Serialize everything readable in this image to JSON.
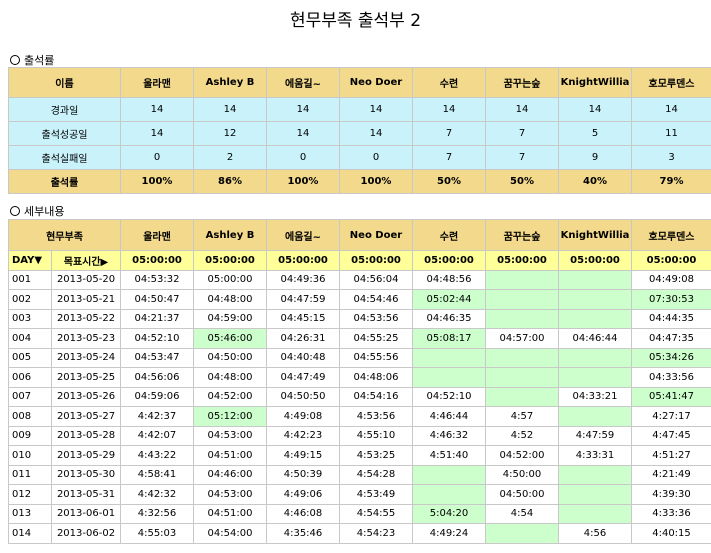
{
  "title": "현무부족 출석부 2",
  "sections": {
    "summary": "출석률",
    "detail": "세부내용"
  },
  "summary": {
    "corner": "이름",
    "members": [
      "울라맨",
      "Ashley B",
      "에움길~",
      "Neo Doer",
      "수련",
      "꿈꾸는숲",
      "KnightWillia",
      "호모루덴스"
    ],
    "rows": [
      {
        "label": "경과일",
        "values": [
          "14",
          "14",
          "14",
          "14",
          "14",
          "14",
          "14",
          "14"
        ]
      },
      {
        "label": "출석성공일",
        "values": [
          "14",
          "12",
          "14",
          "14",
          "7",
          "7",
          "5",
          "11"
        ]
      },
      {
        "label": "출석실패일",
        "values": [
          "0",
          "2",
          "0",
          "0",
          "7",
          "7",
          "9",
          "3"
        ]
      }
    ],
    "ratio": {
      "label": "출석률",
      "values": [
        "100%",
        "86%",
        "100%",
        "100%",
        "50%",
        "50%",
        "40%",
        "79%"
      ]
    }
  },
  "detail": {
    "corner": "현무부족",
    "members": [
      "울라맨",
      "Ashley B",
      "에움길~",
      "Neo Doer",
      "수련",
      "꿈꾸는숲",
      "KnightWillia",
      "호모루덴스"
    ],
    "target": {
      "day_label": "DAY▼",
      "target_label": "목표시간▶",
      "values": [
        "05:00:00",
        "05:00:00",
        "05:00:00",
        "05:00:00",
        "05:00:00",
        "05:00:00",
        "05:00:00",
        "05:00:00"
      ]
    },
    "rows": [
      {
        "day": "001",
        "date": "2013-05-20",
        "values": [
          "04:53:32",
          "05:00:00",
          "04:49:36",
          "04:56:04",
          "04:48:56",
          "",
          "",
          "04:49:08"
        ],
        "green": [
          false,
          false,
          false,
          false,
          false,
          true,
          true,
          false
        ]
      },
      {
        "day": "002",
        "date": "2013-05-21",
        "values": [
          "04:50:47",
          "04:48:00",
          "04:47:59",
          "04:54:46",
          "05:02:44",
          "",
          "",
          "07:30:53"
        ],
        "green": [
          false,
          false,
          false,
          false,
          true,
          true,
          true,
          true
        ]
      },
      {
        "day": "003",
        "date": "2013-05-22",
        "values": [
          "04:21:37",
          "04:59:00",
          "04:45:15",
          "04:53:56",
          "04:46:35",
          "",
          "",
          "04:44:35"
        ],
        "green": [
          false,
          false,
          false,
          false,
          false,
          true,
          true,
          false
        ]
      },
      {
        "day": "004",
        "date": "2013-05-23",
        "values": [
          "04:52:10",
          "05:46:00",
          "04:26:31",
          "04:55:25",
          "05:08:17",
          "04:57:00",
          "04:46:44",
          "04:47:35"
        ],
        "green": [
          false,
          true,
          false,
          false,
          true,
          false,
          false,
          false
        ]
      },
      {
        "day": "005",
        "date": "2013-05-24",
        "values": [
          "04:53:47",
          "04:50:00",
          "04:40:48",
          "04:55:56",
          "",
          "",
          "",
          "05:34:26"
        ],
        "green": [
          false,
          false,
          false,
          false,
          true,
          true,
          true,
          true
        ]
      },
      {
        "day": "006",
        "date": "2013-05-25",
        "values": [
          "04:56:06",
          "04:48:00",
          "04:47:49",
          "04:48:06",
          "",
          "",
          "",
          "04:33:56"
        ],
        "green": [
          false,
          false,
          false,
          false,
          true,
          true,
          true,
          false
        ]
      },
      {
        "day": "007",
        "date": "2013-05-26",
        "values": [
          "04:59:06",
          "04:52:00",
          "04:50:50",
          "04:54:16",
          "04:52:10",
          "",
          "04:33:21",
          "05:41:47"
        ],
        "green": [
          false,
          false,
          false,
          false,
          false,
          true,
          false,
          true
        ]
      },
      {
        "day": "008",
        "date": "2013-05-27",
        "values": [
          "4:42:37",
          "05:12:00",
          "4:49:08",
          "4:53:56",
          "4:46:44",
          "4:57",
          "",
          "4:27:17"
        ],
        "green": [
          false,
          true,
          false,
          false,
          false,
          false,
          true,
          false
        ]
      },
      {
        "day": "009",
        "date": "2013-05-28",
        "values": [
          "4:42:07",
          "04:53:00",
          "4:42:23",
          "4:55:10",
          "4:46:32",
          "4:52",
          "4:47:59",
          "4:47:45"
        ],
        "green": [
          false,
          false,
          false,
          false,
          false,
          false,
          false,
          false
        ]
      },
      {
        "day": "010",
        "date": "2013-05-29",
        "values": [
          "4:43:22",
          "04:51:00",
          "4:49:15",
          "4:53:25",
          "4:51:40",
          "04:52:00",
          "4:33:31",
          "4:51:27"
        ],
        "green": [
          false,
          false,
          false,
          false,
          false,
          false,
          false,
          false
        ]
      },
      {
        "day": "011",
        "date": "2013-05-30",
        "values": [
          "4:58:41",
          "04:46:00",
          "4:50:39",
          "4:54:28",
          "",
          "4:50:00",
          "",
          "4:21:49"
        ],
        "green": [
          false,
          false,
          false,
          false,
          true,
          false,
          true,
          false
        ]
      },
      {
        "day": "012",
        "date": "2013-05-31",
        "values": [
          "4:42:32",
          "04:53:00",
          "4:49:06",
          "4:53:49",
          "",
          "04:50:00",
          "",
          "4:39:30"
        ],
        "green": [
          false,
          false,
          false,
          false,
          true,
          false,
          true,
          false
        ]
      },
      {
        "day": "013",
        "date": "2013-06-01",
        "values": [
          "4:32:56",
          "04:51:00",
          "4:46:08",
          "4:54:55",
          "5:04:20",
          "4:54",
          "",
          "4:33:36"
        ],
        "green": [
          false,
          false,
          false,
          false,
          true,
          false,
          true,
          false
        ]
      },
      {
        "day": "014",
        "date": "2013-06-02",
        "values": [
          "4:55:03",
          "04:54:00",
          "4:35:46",
          "4:54:23",
          "4:49:24",
          "",
          "4:56",
          "4:40:15"
        ],
        "green": [
          false,
          false,
          false,
          false,
          false,
          true,
          false,
          false
        ]
      }
    ]
  }
}
